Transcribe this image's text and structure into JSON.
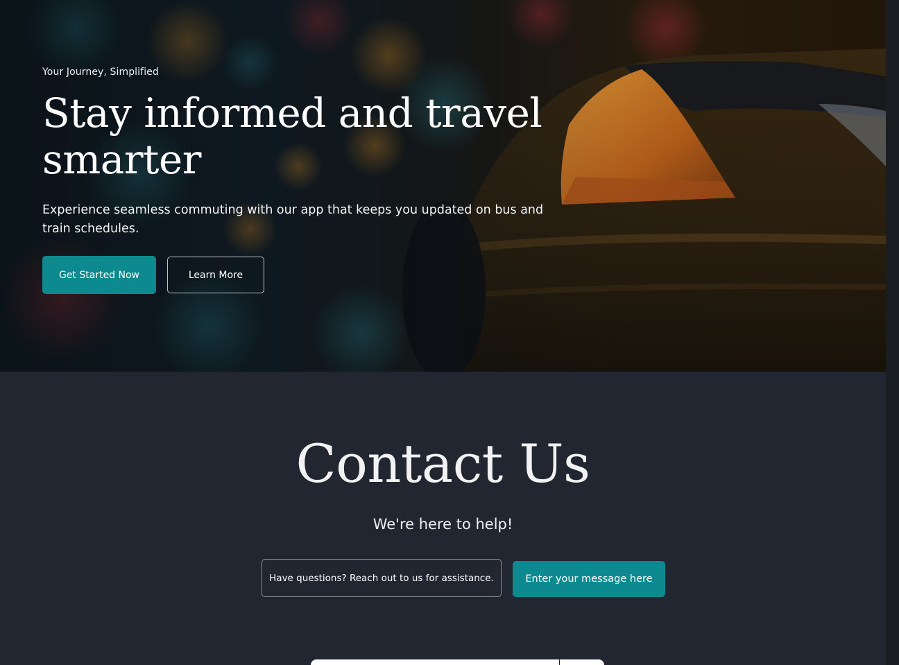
{
  "hero": {
    "eyebrow": "Your Journey, Simplified",
    "title": "Stay informed and travel smarter",
    "subtitle": "Experience seamless commuting with our app that keeps you updated on bus and train schedules.",
    "primary_button": "Get Started Now",
    "secondary_button": "Learn More",
    "background_image": "night-city-taxi-photo"
  },
  "contact": {
    "title": "Contact Us",
    "subtitle": "We're here to help!",
    "message_box": "Have questions? Reach out to us for assistance.",
    "message_button": "Enter your message here"
  },
  "colors": {
    "accent": "#0d8a8f",
    "section_bg": "#212631"
  }
}
